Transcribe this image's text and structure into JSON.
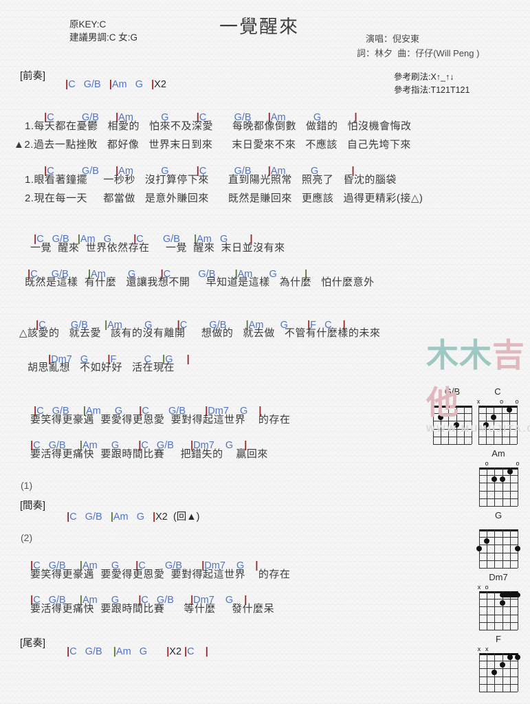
{
  "header": {
    "orig_key": "原KEY:C",
    "suggest_key": "建議男調:C 女:G",
    "title": "一覺醒來",
    "singer": "演唱：倪安東",
    "writer": "詞：林夕  曲：仔仔(Will Peng )",
    "strum_ref": "參考刷法:X↑_↑↓",
    "finger_ref": "參考指法:T121T121"
  },
  "watermark": {
    "cn": "木木吉他",
    "url": "WWW.MUMUJITA.COM"
  },
  "sections": [
    {
      "id": "intro",
      "label": "[前奏]",
      "chords": "|C   G/B   |Am   G   |X2"
    },
    {
      "id": "interlude",
      "label": "[間奏]",
      "chords": "|C   G/B   |Am   G   |X2  (回▲)",
      "number": "(1)"
    },
    {
      "id": "outro",
      "label": "[尾奏]",
      "chords": "|C   G/B   |Am   G      |X2 |C   |"
    }
  ],
  "verse1": {
    "chords_a": [
      {
        "t": "|",
        "c": "bar"
      },
      {
        "t": "C",
        "c": "ch"
      },
      {
        "t": "G/B",
        "c": "ch"
      },
      {
        "t": "|",
        "c": "bar"
      },
      {
        "t": "Am",
        "c": "ch"
      },
      {
        "t": "G",
        "c": "ch"
      },
      {
        "t": "|",
        "c": "bar"
      },
      {
        "t": "C",
        "c": "ch"
      },
      {
        "t": "G/B",
        "c": "ch"
      },
      {
        "t": "|",
        "c": "bar"
      },
      {
        "t": "Am",
        "c": "ch"
      },
      {
        "t": "G",
        "c": "ch"
      },
      {
        "t": "|",
        "c": "bar"
      }
    ],
    "line1": "1.每天都在憂鬱   相愛的   怕來不及深愛      每晚都像倒數   做錯的   怕沒機會悔改",
    "line2": "▲2.過去一點挫敗   都好像   世界末日到來      末日愛來不來   不應該   自己先垮下來",
    "line3": "1.眼看著鐘擺     一秒秒   沒打算停下來      直到陽光照常   照亮了   昏沈的腦袋",
    "line4": "2.現在每一天     都當做   是意外賺回來      既然是賺回來   更應該   過得更精彩(接△)"
  },
  "chorus1": {
    "line1": "一覺  醒來  世界依然存在     一覺  醒來  末日並沒有來",
    "line2": "既然是這樣  有什麼   還讓我想不開     早知道是這樣   為什麼   怕什麼意外"
  },
  "bridge": {
    "line1": "△該愛的   就去愛   該有的沒有離開     想做的   就去做   不管有什麼樣的未來",
    "line2": "胡思亂想   不如好好   活在現在"
  },
  "chorus2": {
    "line1": "要笑得更豪邁  要愛得更恩愛  要對得起這世界    的存在",
    "line2": "要活得更痛快  要跟時間比賽     把錯失的    贏回來"
  },
  "chorus3": {
    "number": "(2)",
    "line1": "要笑得更豪邁  要愛得更恩愛  要對得起這世界    的存在",
    "line2": "要活得更痛快  要跟時間比賽      等什麼     發什麼呆"
  },
  "chord_rows": {
    "r1": "|C       G/B     |Am       G         |C       G/B     |Am       G         |",
    "r2": "|C    G/B    |Am   G         |C       G/B     |Am    G         |",
    "r3": "|C    G/B      |Am        G          |C          G/B       |Am      G          |",
    "r4": "|C       G/B     |Am       G         |C       G/B     |Am      G        |F   C    |",
    "r5": "|Dm7   G      |F        C    |G    |",
    "r6": "|C   G/B    |Am    G     |C      G/B      |Dm7    G    |",
    "r7": "|C   G/B    |Am    G      |C   G/B     |Dm7    G    |"
  },
  "diagrams": [
    {
      "name": "G/B",
      "marks": [
        {
          "s": "x",
          "str": 6
        }
      ],
      "dots": [
        {
          "str": 5,
          "fret": 2
        },
        {
          "str": 3,
          "fret": 3
        }
      ],
      "barres": []
    },
    {
      "name": "C",
      "marks": [
        {
          "s": "x",
          "str": 6
        },
        {
          "s": "o",
          "str": 3
        },
        {
          "s": "o",
          "str": 1
        }
      ],
      "dots": [
        {
          "str": 5,
          "fret": 3
        },
        {
          "str": 4,
          "fret": 2
        },
        {
          "str": 2,
          "fret": 1
        }
      ],
      "barres": []
    },
    {
      "name": "Am",
      "marks": [
        {
          "s": "o",
          "str": 5
        },
        {
          "s": "o",
          "str": 1
        }
      ],
      "dots": [
        {
          "str": 2,
          "fret": 1
        },
        {
          "str": 4,
          "fret": 2
        },
        {
          "str": 3,
          "fret": 2
        }
      ],
      "barres": []
    },
    {
      "name": "G",
      "marks": [],
      "dots": [
        {
          "str": 5,
          "fret": 2
        },
        {
          "str": 6,
          "fret": 3
        },
        {
          "str": 1,
          "fret": 3
        }
      ],
      "barres": []
    },
    {
      "name": "Dm7",
      "marks": [
        {
          "s": "x",
          "str": 6
        },
        {
          "s": "o",
          "str": 5
        }
      ],
      "dots": [
        {
          "str": 3,
          "fret": 2
        }
      ],
      "barres": [
        {
          "from": 3,
          "to": 1,
          "fret": 1
        }
      ]
    },
    {
      "name": "F",
      "marks": [
        {
          "s": "x",
          "str": 6
        },
        {
          "s": "x",
          "str": 5
        }
      ],
      "dots": [
        {
          "str": 2,
          "fret": 1
        },
        {
          "str": 1,
          "fret": 1
        },
        {
          "str": 3,
          "fret": 2
        },
        {
          "str": 4,
          "fret": 3
        }
      ],
      "barres": []
    }
  ]
}
